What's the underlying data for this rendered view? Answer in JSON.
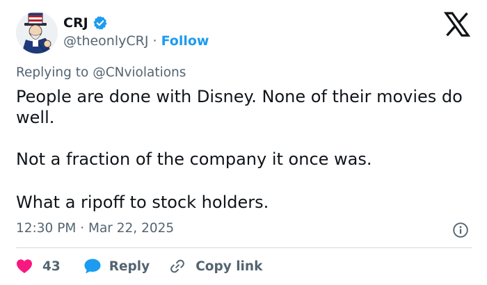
{
  "author": {
    "name": "CRJ",
    "handle": "@theonlyCRJ",
    "separator": "·",
    "follow_label": "Follow"
  },
  "reply_context": {
    "prefix": "Replying to",
    "mention": "@CNviolations"
  },
  "tweet": {
    "paragraphs": [
      "People are done with Disney.  None of their movies do well.",
      "Not a fraction of the company it once was.",
      "What a ripoff to stock holders."
    ],
    "time": "12:30 PM",
    "date_separator": "·",
    "date": "Mar 22, 2025"
  },
  "actions": {
    "like_count": "43",
    "reply_label": "Reply",
    "copy_label": "Copy link"
  },
  "icons": {
    "verified": "verified-badge-icon",
    "logo": "x-logo-icon",
    "info": "info-icon",
    "like": "heart-icon",
    "reply": "speech-bubble-icon",
    "copy": "link-icon"
  },
  "colors": {
    "accent": "#1d9bf0",
    "like": "#f91880",
    "text": "#0f1419",
    "secondary": "#536471",
    "divider": "#cfd9de"
  }
}
